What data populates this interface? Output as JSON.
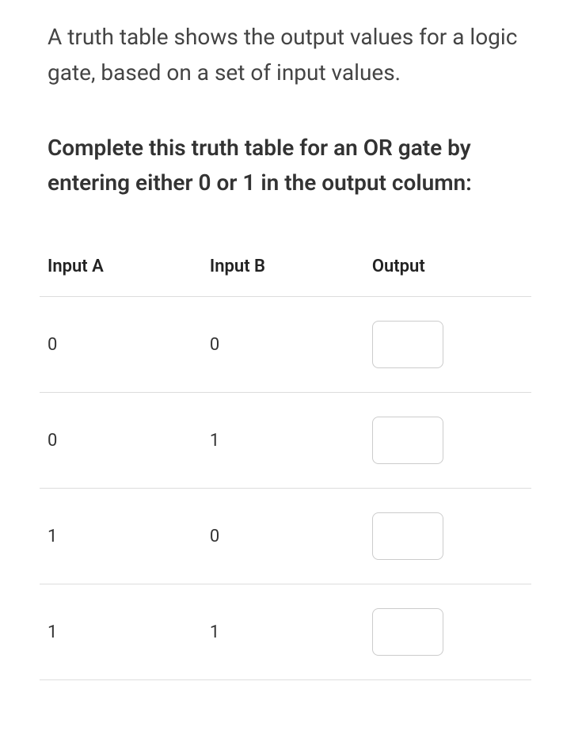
{
  "intro": "A truth table shows the output values for a logic gate, based on a set of input values.",
  "instruction": "Complete this truth table for an OR gate by entering either 0 or 1 in the output column:",
  "table": {
    "headers": {
      "col_a": "Input A",
      "col_b": "Input B",
      "col_out": "Output"
    },
    "rows": [
      {
        "input_a": "0",
        "input_b": "0",
        "output": ""
      },
      {
        "input_a": "0",
        "input_b": "1",
        "output": ""
      },
      {
        "input_a": "1",
        "input_b": "0",
        "output": ""
      },
      {
        "input_a": "1",
        "input_b": "1",
        "output": ""
      }
    ]
  }
}
